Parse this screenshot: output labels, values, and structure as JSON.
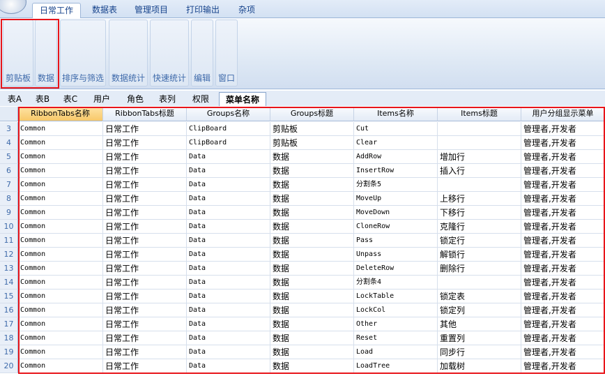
{
  "ribbon": {
    "tabs": [
      "日常工作",
      "数据表",
      "管理项目",
      "打印输出",
      "杂项"
    ],
    "active_tab": "日常工作",
    "groups": [
      "剪贴板",
      "数据",
      "排序与筛选",
      "数据统计",
      "快速统计",
      "编辑",
      "窗口"
    ]
  },
  "sheet_tabs": [
    "表A",
    "表B",
    "表C",
    "用户",
    "角色",
    "表列",
    "权限",
    "菜单名称"
  ],
  "active_sheet": "菜单名称",
  "grid": {
    "columns": [
      "RibbonTabs名称",
      "RibbonTabs标题",
      "Groups名称",
      "Groups标题",
      "Items名称",
      "Items标题",
      "用户分组显示菜单"
    ],
    "rows": [
      {
        "n": "3",
        "cells": [
          "Common",
          "日常工作",
          "ClipBoard",
          "剪贴板",
          "Cut",
          "",
          "管理者,开发者"
        ]
      },
      {
        "n": "4",
        "cells": [
          "Common",
          "日常工作",
          "ClipBoard",
          "剪贴板",
          "Clear",
          "",
          "管理者,开发者"
        ]
      },
      {
        "n": "5",
        "cells": [
          "Common",
          "日常工作",
          "Data",
          "数据",
          "AddRow",
          "增加行",
          "管理者,开发者"
        ]
      },
      {
        "n": "6",
        "cells": [
          "Common",
          "日常工作",
          "Data",
          "数据",
          "InsertRow",
          "插入行",
          "管理者,开发者"
        ]
      },
      {
        "n": "7",
        "cells": [
          "Common",
          "日常工作",
          "Data",
          "数据",
          "分割条5",
          "",
          "管理者,开发者"
        ]
      },
      {
        "n": "8",
        "cells": [
          "Common",
          "日常工作",
          "Data",
          "数据",
          "MoveUp",
          "上移行",
          "管理者,开发者"
        ]
      },
      {
        "n": "9",
        "cells": [
          "Common",
          "日常工作",
          "Data",
          "数据",
          "MoveDown",
          "下移行",
          "管理者,开发者"
        ]
      },
      {
        "n": "10",
        "cells": [
          "Common",
          "日常工作",
          "Data",
          "数据",
          "CloneRow",
          "克隆行",
          "管理者,开发者"
        ]
      },
      {
        "n": "11",
        "cells": [
          "Common",
          "日常工作",
          "Data",
          "数据",
          "Pass",
          "锁定行",
          "管理者,开发者"
        ]
      },
      {
        "n": "12",
        "cells": [
          "Common",
          "日常工作",
          "Data",
          "数据",
          "Unpass",
          "解锁行",
          "管理者,开发者"
        ]
      },
      {
        "n": "13",
        "cells": [
          "Common",
          "日常工作",
          "Data",
          "数据",
          "DeleteRow",
          "删除行",
          "管理者,开发者"
        ]
      },
      {
        "n": "14",
        "cells": [
          "Common",
          "日常工作",
          "Data",
          "数据",
          "分割条4",
          "",
          "管理者,开发者"
        ]
      },
      {
        "n": "15",
        "cells": [
          "Common",
          "日常工作",
          "Data",
          "数据",
          "LockTable",
          "锁定表",
          "管理者,开发者"
        ]
      },
      {
        "n": "16",
        "cells": [
          "Common",
          "日常工作",
          "Data",
          "数据",
          "LockCol",
          "锁定列",
          "管理者,开发者"
        ]
      },
      {
        "n": "17",
        "cells": [
          "Common",
          "日常工作",
          "Data",
          "数据",
          "Other",
          "其他",
          "管理者,开发者"
        ]
      },
      {
        "n": "18",
        "cells": [
          "Common",
          "日常工作",
          "Data",
          "数据",
          "Reset",
          "重置列",
          "管理者,开发者"
        ]
      },
      {
        "n": "19",
        "cells": [
          "Common",
          "日常工作",
          "Data",
          "数据",
          "Load",
          "同步行",
          "管理者,开发者"
        ]
      },
      {
        "n": "20",
        "cells": [
          "Common",
          "日常工作",
          "Data",
          "数据",
          "LoadTree",
          "加载树",
          "管理者,开发者"
        ]
      }
    ]
  },
  "colors": {
    "highlight": "#e8141a",
    "selected_header": "#f8c869"
  }
}
